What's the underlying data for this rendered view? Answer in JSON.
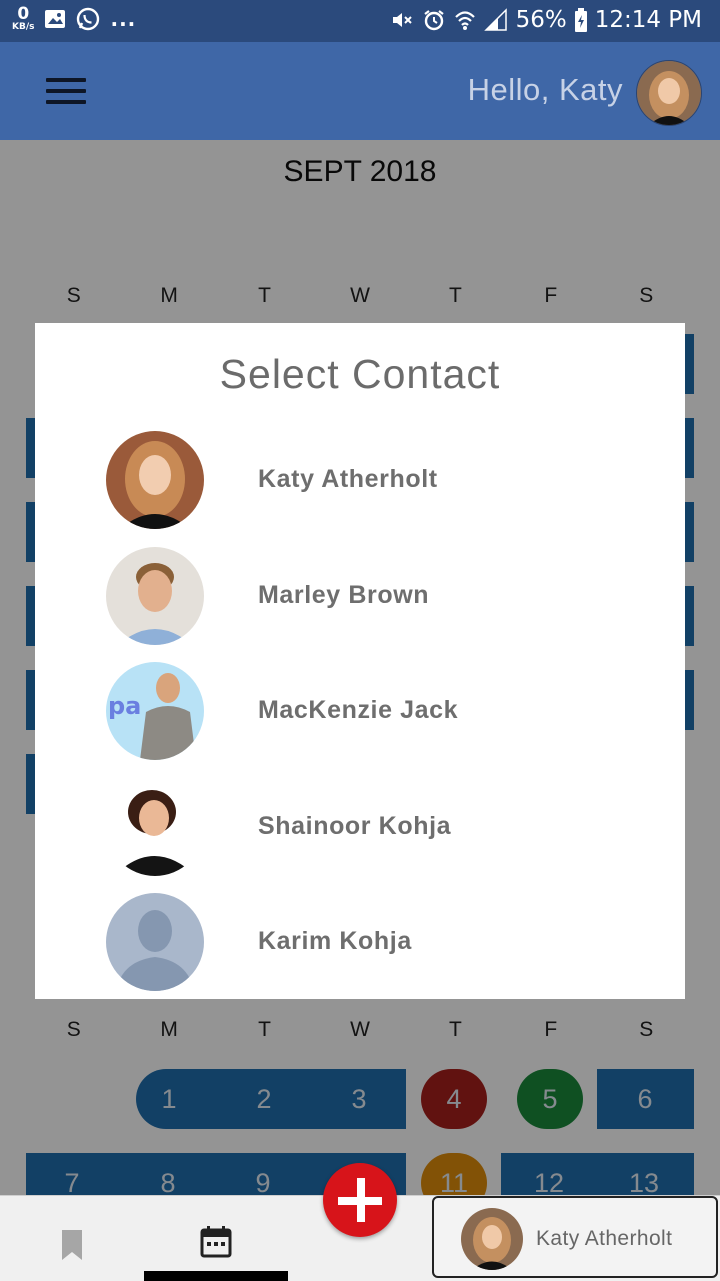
{
  "status_bar": {
    "net_speed": "0",
    "net_unit": "KB/s",
    "more": "...",
    "battery": "56%",
    "time": "12:14 PM"
  },
  "header": {
    "greeting": "Hello, Katy"
  },
  "calendar": {
    "month": "SEPT 2018",
    "weekdays": [
      "S",
      "M",
      "T",
      "W",
      "T",
      "F",
      "S"
    ],
    "days": [
      "1",
      "2",
      "3",
      "4",
      "5",
      "6",
      "7",
      "8",
      "9",
      "11",
      "12",
      "13"
    ]
  },
  "dialog": {
    "title": "Select Contact",
    "contacts": [
      {
        "name": "Katy Atherholt"
      },
      {
        "name": "Marley Brown"
      },
      {
        "name": "MacKenzie Jack"
      },
      {
        "name": "Shainoor Kohja"
      },
      {
        "name": "Karim Kohja"
      }
    ]
  },
  "profile_chip": {
    "name": "Katy Atherholt"
  },
  "colors": {
    "header": "#3f67a7",
    "status_bar": "#2b4a7c",
    "calendar_blue": "#1f6fae",
    "day4": "#a8201c",
    "day5": "#1a8a3c",
    "day11": "#e08e0b",
    "fab": "#d7141a"
  }
}
